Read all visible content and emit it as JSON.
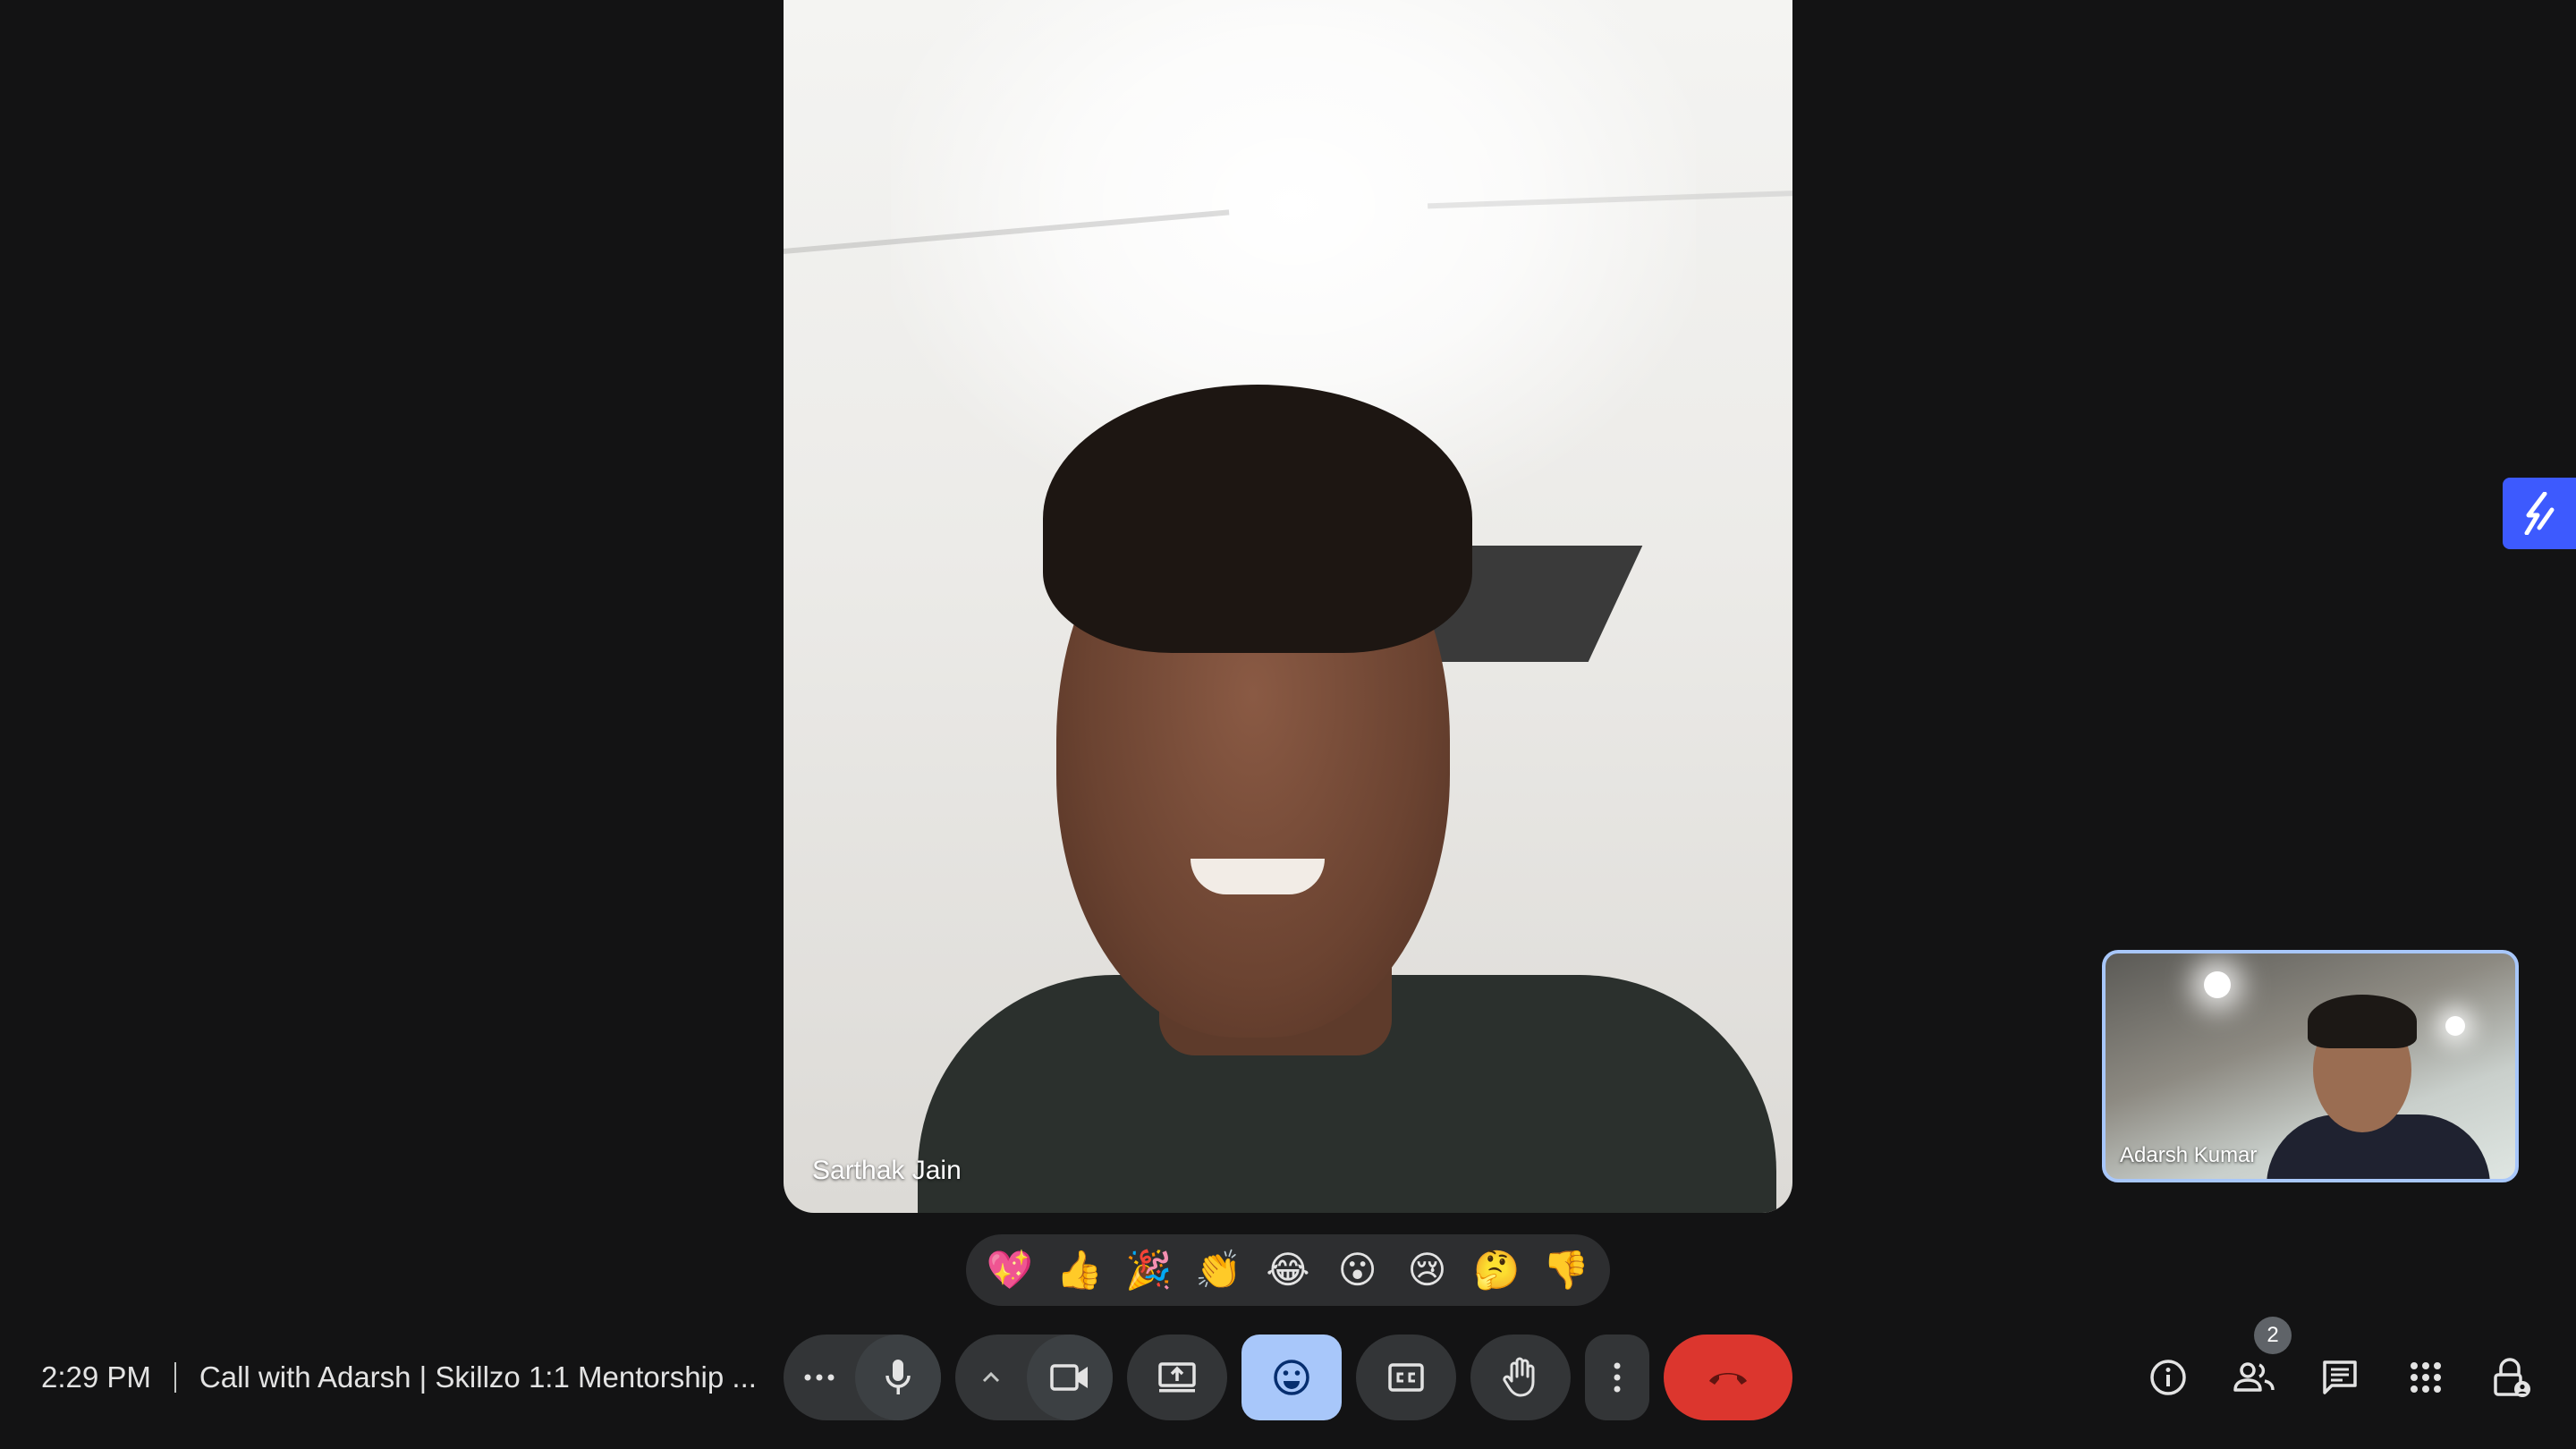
{
  "main_participant": {
    "name": "Sarthak Jain"
  },
  "self_view": {
    "name": "Adarsh Kumar"
  },
  "reactions": [
    "💖",
    "👍",
    "🎉",
    "👏",
    "😂",
    "😮",
    "😢",
    "🤔",
    "👎"
  ],
  "meeting": {
    "time": "2:29 PM",
    "title": "Call with Adarsh | Skillzo 1:1 Mentorship ..."
  },
  "controls": {
    "more_options_icon": "more-horiz-icon",
    "mic_icon": "mic-icon",
    "caret_icon": "chevron-up-icon",
    "camera_icon": "videocam-icon",
    "present_icon": "present-screen-icon",
    "emoji_icon": "emoji-icon",
    "captions_icon": "closed-captions-icon",
    "hand_icon": "raise-hand-icon",
    "overflow_icon": "more-vert-icon",
    "leave_icon": "call-end-icon"
  },
  "right_panel": {
    "people_count": "2",
    "icons": [
      "info-icon",
      "people-icon",
      "chat-icon",
      "activities-icon",
      "host-controls-icon"
    ]
  },
  "colors": {
    "background": "#131314",
    "control": "#333537",
    "active_emoji": "#a8c7fa",
    "leave": "#dc362e",
    "self_border": "#a8c7fa",
    "extension": "#3d5afe"
  }
}
